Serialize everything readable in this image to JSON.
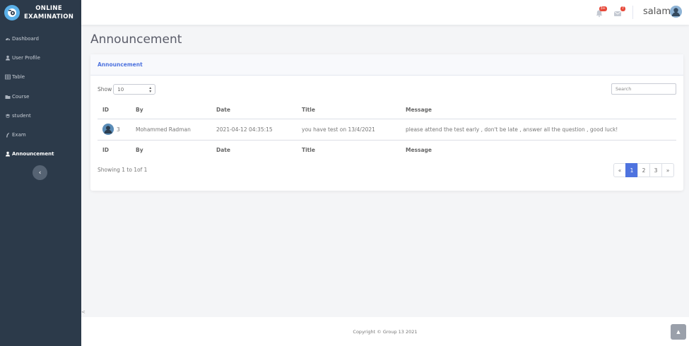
{
  "brand": {
    "line1": "ONLINE",
    "line2": "EXAMINATION"
  },
  "sidebar": {
    "items": [
      {
        "label": "Dashboard",
        "icon": "dashboard-icon",
        "active": false
      },
      {
        "label": "User Profile",
        "icon": "user-icon",
        "active": false
      },
      {
        "label": "Table",
        "icon": "table-icon",
        "active": false
      },
      {
        "label": "Course",
        "icon": "course-icon",
        "active": false
      },
      {
        "label": "student",
        "icon": "student-icon",
        "active": false
      },
      {
        "label": "Exam",
        "icon": "exam-icon",
        "active": false
      },
      {
        "label": "Announcement",
        "icon": "user-icon",
        "active": true
      }
    ],
    "collapse_label": "‹"
  },
  "topbar": {
    "alerts_badge": "3+",
    "messages_badge": "7",
    "username": "salam"
  },
  "page_title": "Announcement",
  "card": {
    "header": "Announcement",
    "show_label": "Show",
    "page_size": "10",
    "search_placeholder": "Search",
    "columns": [
      "ID",
      "By",
      "Date",
      "Title",
      "Message"
    ],
    "rows": [
      {
        "id": "3",
        "by": "Mohammed Radman",
        "date": "2021-04-12 04:35:15",
        "title": "you have test on 13/4/2021",
        "message": "please attend the test early , don't be late , answer all the question , good luck!"
      }
    ],
    "info": "Showing 1 to 1of 1",
    "pagination": [
      "«",
      "1",
      "2",
      "3",
      "»"
    ]
  },
  "footer": {
    "text": "Copyright © Group 13 2021"
  },
  "colors": {
    "sidebar": "#2c3a4a",
    "accent": "#4e73df",
    "badge": "#e74a3b"
  }
}
